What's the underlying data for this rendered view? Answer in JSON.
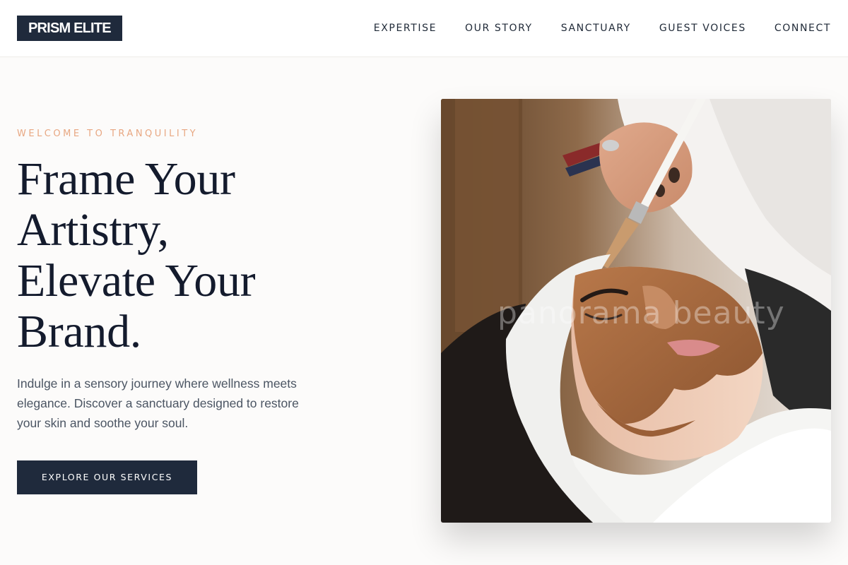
{
  "brand": {
    "name": "PRISM ELITE"
  },
  "nav": {
    "items": [
      "EXPERTISE",
      "OUR STORY",
      "SANCTUARY",
      "GUEST VOICES",
      "CONNECT"
    ]
  },
  "hero": {
    "eyebrow": "WELCOME TO TRANQUILITY",
    "headline_lines": [
      "Frame Your",
      "Artistry,",
      "Elevate Your",
      "Brand."
    ],
    "description": "Indulge in a sensory journey where wellness meets elegance. Discover a sanctuary designed to restore your skin and soothe your soul.",
    "cta_label": "EXPLORE OUR SERVICES",
    "image_watermark": "panorama beauty"
  },
  "colors": {
    "brand_navy": "#1f2a3c",
    "accent_peach": "#e8a883",
    "page_background": "#fcfbfa"
  }
}
